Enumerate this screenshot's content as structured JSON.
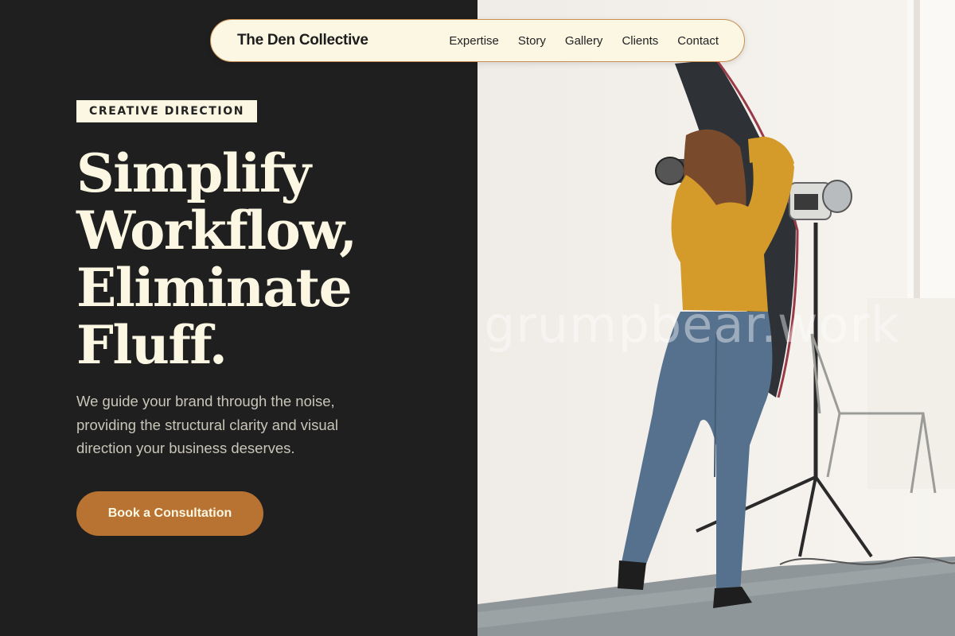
{
  "nav": {
    "brand": "The Den Collective",
    "links": [
      "Expertise",
      "Story",
      "Gallery",
      "Clients",
      "Contact"
    ]
  },
  "hero": {
    "eyebrow": "CREATIVE DIRECTION",
    "headline_lines": [
      "Simplify",
      "Workflow,",
      "Eliminate",
      "Fluff."
    ],
    "lead": "We guide your brand through the noise, providing the structural clarity and visual direction your business deserves.",
    "cta_label": "Book a Consultation"
  },
  "photo": {
    "watermark": "grumpbear.work"
  },
  "colors": {
    "background": "#1f1f1f",
    "cream": "#fbf7e3",
    "accent": "#b87332",
    "nav_border": "#c98f54"
  }
}
